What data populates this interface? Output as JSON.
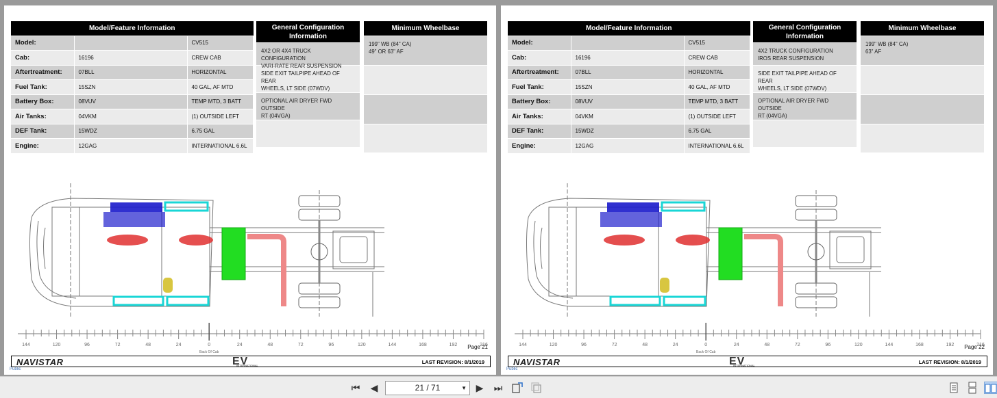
{
  "viewer": {
    "page_indicator": "21 / 71",
    "toolbar_icons": [
      "first-page-icon",
      "previous-page-icon",
      "next-page-icon",
      "last-page-icon",
      "rotate-icon",
      "copy-icon",
      "single-page-icon",
      "continuous-icon",
      "two-page-icon"
    ]
  },
  "labels": {
    "model_feature_header": "Model/Feature Information",
    "general_config_header_1": "General Configuration",
    "general_config_header_2": "Information",
    "min_wheelbase_header": "Minimum Wheelbase",
    "back_of_cab": "Back Of Cab",
    "brand": "NAVISTAR",
    "ev_logo": "EV",
    "ev_sub": "INTERNATIONAL",
    "revision": "LAST REVISION: 8/1/2019",
    "public": "Public"
  },
  "ruler_ticks": [
    "144",
    "120",
    "96",
    "72",
    "48",
    "24",
    "0",
    "24",
    "48",
    "72",
    "96",
    "120",
    "144",
    "168",
    "192",
    "216"
  ],
  "pages": [
    {
      "page_label": "Page 21",
      "rows": [
        {
          "label": "Model:",
          "code": "",
          "value": "CV515"
        },
        {
          "label": "Cab:",
          "code": "16196",
          "value": "CREW CAB"
        },
        {
          "label": "Aftertreatment:",
          "code": "07BLL",
          "value": "HORIZONTAL"
        },
        {
          "label": "Fuel Tank:",
          "code": "15SZN",
          "value": "40 GAL, AF MTD"
        },
        {
          "label": "Battery Box:",
          "code": "08VUV",
          "value": "TEMP MTD, 3 BATT"
        },
        {
          "label": "Air Tanks:",
          "code": "04VKM",
          "value": "(1) OUTSIDE LEFT"
        },
        {
          "label": "DEF Tank:",
          "code": "15WDZ",
          "value": "6.75 GAL"
        },
        {
          "label": "Engine:",
          "code": "12GAG",
          "value": "INTERNATIONAL 6.6L"
        }
      ],
      "general_config": [
        {
          "line1": "4X2 OR 4X4 TRUCK CONFIGURATION",
          "line2": "VARI-RATE REAR SUSPENSION"
        },
        {
          "line1": "SIDE EXIT TAILPIPE AHEAD OF REAR",
          "line2": "WHEELS, LT SIDE (07WDV)"
        },
        {
          "line1": "OPTIONAL AIR DRYER FWD OUTSIDE",
          "line2": "RT (04VGA)"
        },
        {
          "line1": "",
          "line2": ""
        }
      ],
      "min_wheelbase": {
        "line1": "199\" WB (84\" CA)",
        "line2": "49\" OR 63\" AF"
      }
    },
    {
      "page_label": "Page 22",
      "rows": [
        {
          "label": "Model:",
          "code": "",
          "value": "CV515"
        },
        {
          "label": "Cab:",
          "code": "16196",
          "value": "CREW CAB"
        },
        {
          "label": "Aftertreatment:",
          "code": "07BLL",
          "value": "HORIZONTAL"
        },
        {
          "label": "Fuel Tank:",
          "code": "15SZN",
          "value": "40 GAL, AF MTD"
        },
        {
          "label": "Battery Box:",
          "code": "08VUV",
          "value": "TEMP MTD, 3 BATT"
        },
        {
          "label": "Air Tanks:",
          "code": "04VKM",
          "value": "(1) OUTSIDE LEFT"
        },
        {
          "label": "DEF Tank:",
          "code": "15WDZ",
          "value": "6.75 GAL"
        },
        {
          "label": "Engine:",
          "code": "12GAG",
          "value": "INTERNATIONAL 6.6L"
        }
      ],
      "general_config": [
        {
          "line1": "4X2 TRUCK CONFIGURATION",
          "line2": "IROS REAR SUSPENSION"
        },
        {
          "line1": "SIDE EXIT TAILPIPE AHEAD OF REAR",
          "line2": "WHEELS, LT SIDE (07WDV)"
        },
        {
          "line1": "OPTIONAL AIR DRYER FWD OUTSIDE",
          "line2": "RT (04VGA)"
        },
        {
          "line1": "",
          "line2": ""
        }
      ],
      "min_wheelbase": {
        "line1": "199\" WB (84\" CA)",
        "line2": "63\" AF"
      }
    }
  ],
  "colors": {
    "aftertreatment": "#1a1acc",
    "air_tanks": "#19d6d6",
    "fuel_tank": "#e03030",
    "battery_box": "#22dd22",
    "tailpipe": "#ee8888",
    "def_tank": "#d8c640"
  }
}
